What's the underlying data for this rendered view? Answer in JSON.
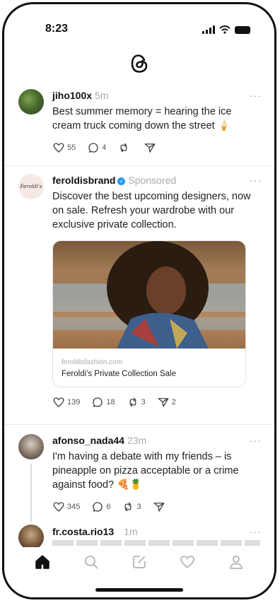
{
  "status_bar": {
    "time": "8:23"
  },
  "feed": {
    "posts": [
      {
        "username": "jiho100x",
        "time": "5m",
        "text": "Best summer memory = hearing the ice cream truck coming down the street 🍦",
        "likes": "55",
        "replies": "4",
        "reposts": "",
        "shares": ""
      },
      {
        "username": "feroldisbrand",
        "sponsored_label": "Sponsored",
        "avatar_text": "Feroldi's",
        "text": "Discover the best upcoming designers, now on sale. Refresh your wardrobe with our exclusive private collection.",
        "card_url": "feroldisfashion.com",
        "card_title": "Feroldi's Private Collection Sale",
        "likes": "139",
        "replies": "18",
        "reposts": "3",
        "shares": "2"
      },
      {
        "username": "afonso_nada44",
        "time": "23m",
        "text": "I'm having a debate with my friends – is pineapple on pizza acceptable or a crime against food? 🍕🍍",
        "likes": "345",
        "replies": "6",
        "reposts": "3",
        "shares": ""
      },
      {
        "username": "fr.costa.rio13",
        "time": "1m",
        "text": ""
      }
    ]
  },
  "more_icon": "···",
  "colors": {
    "verified": "#1d9bf0",
    "accent": "#111111"
  }
}
